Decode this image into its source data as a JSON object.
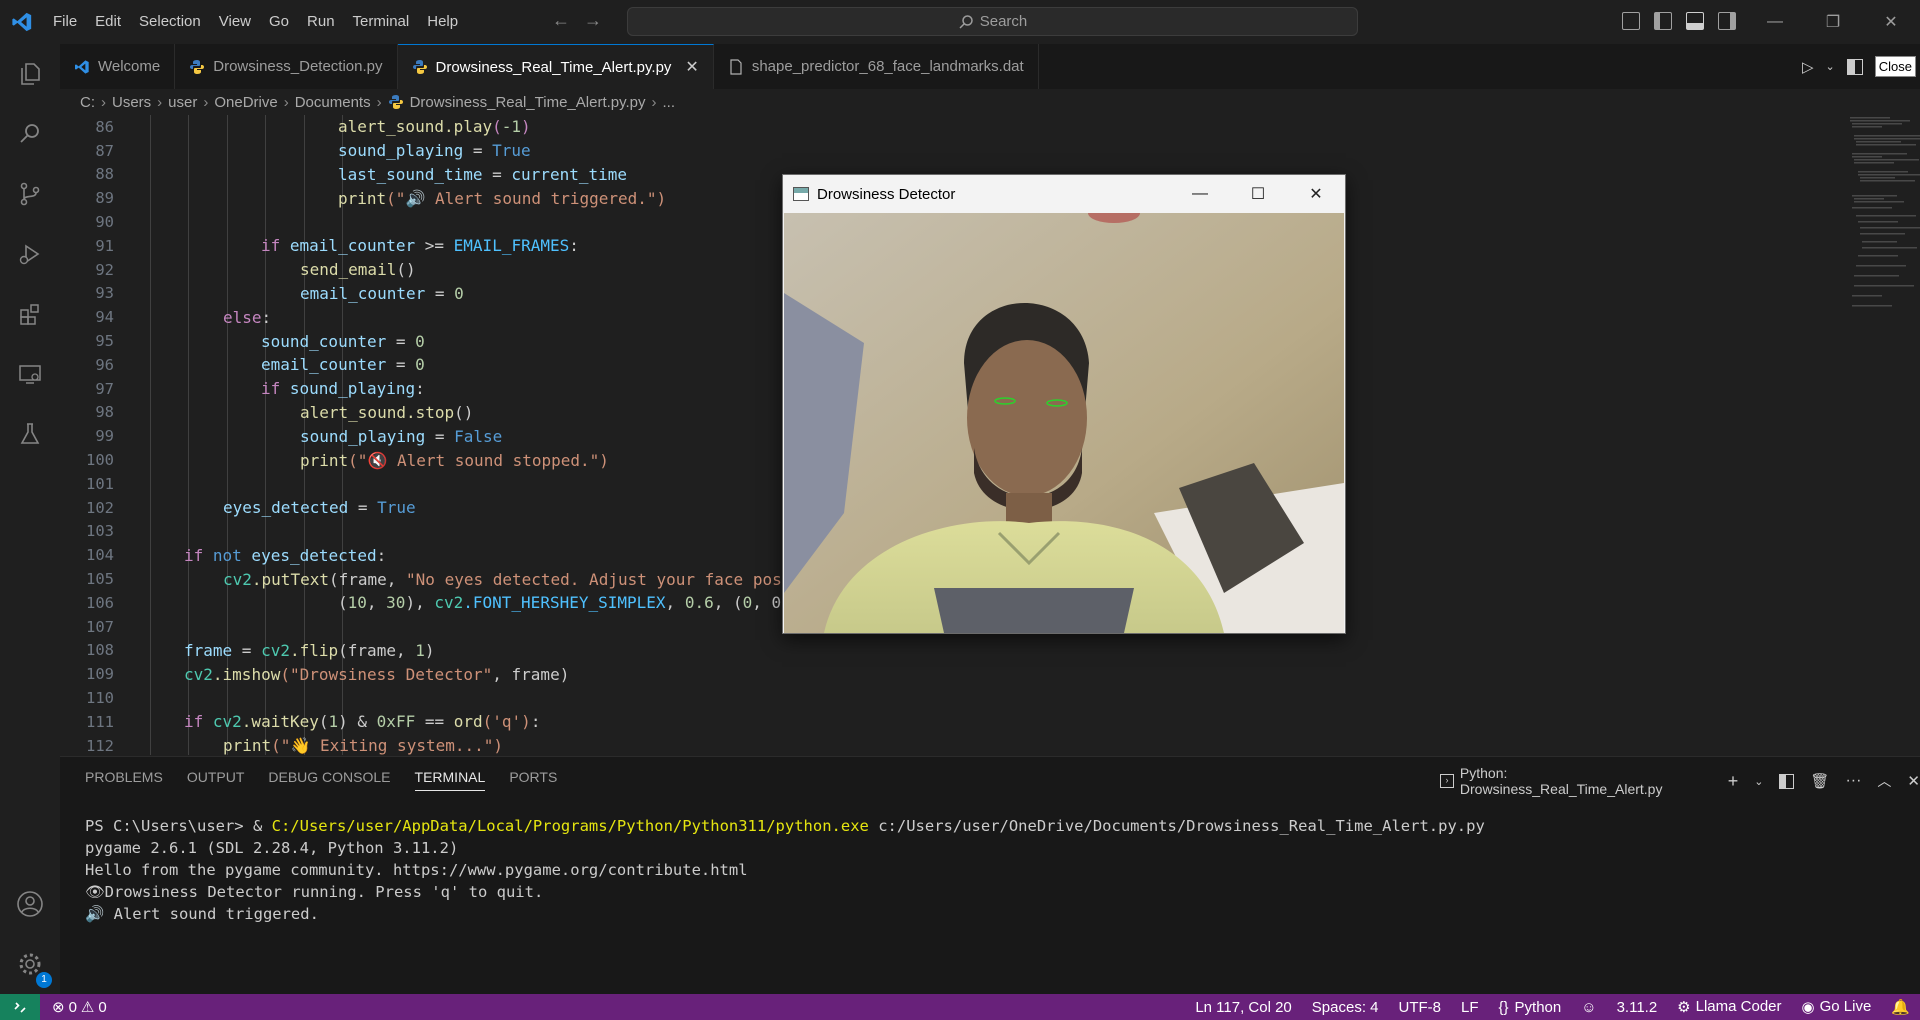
{
  "menu": [
    "File",
    "Edit",
    "Selection",
    "View",
    "Go",
    "Run",
    "Terminal",
    "Help"
  ],
  "search": {
    "label": "Search"
  },
  "tabs": [
    {
      "label": "Welcome",
      "icon": "vscode-icon"
    },
    {
      "label": "Drowsiness_Detection.py",
      "icon": "python-icon"
    },
    {
      "label": "Drowsiness_Real_Time_Alert.py.py",
      "icon": "python-icon",
      "active": true
    },
    {
      "label": "shape_predictor_68_face_landmarks.dat",
      "icon": "file-icon"
    }
  ],
  "tooltip": "Close",
  "breadcrumb": [
    "C:",
    "Users",
    "user",
    "OneDrive",
    "Documents",
    "Drowsiness_Real_Time_Alert.py.py",
    "..."
  ],
  "code": {
    "line_numbers": [
      "86",
      "87",
      "88",
      "89",
      "90",
      "91",
      "92",
      "93",
      "94",
      "95",
      "96",
      "97",
      "98",
      "99",
      "100",
      "101",
      "102",
      "103",
      "104",
      "105",
      "106",
      "107",
      "108",
      "109",
      "110",
      "111",
      "112"
    ],
    "l86_fn": "alert_sound.play",
    "l86_paren": "(",
    "l86_num": "-1",
    "l86_close": ")",
    "l87_var": "sound_playing",
    "l87_op": " = ",
    "l87_val": "True",
    "l88_var": "last_sound_time",
    "l88_op": " = ",
    "l88_val": "current_time",
    "l89_fn": "print",
    "l89_str": "(\"🔊 Alert sound triggered.\")",
    "l91_kw": "if",
    "l91_var": " email_counter",
    "l91_op": " >= ",
    "l91_const": "EMAIL_FRAMES",
    "l91_colon": ":",
    "l92_fn": "send_email",
    "l92_rest": "()",
    "l93_var": "email_counter",
    "l93_op": " = ",
    "l93_num": "0",
    "l94_kw": "else",
    "l94_colon": ":",
    "l95_var": "sound_counter",
    "l95_op": " = ",
    "l95_num": "0",
    "l96_var": "email_counter",
    "l96_op": " = ",
    "l96_num": "0",
    "l97_kw": "if",
    "l97_var": " sound_playing",
    "l97_colon": ":",
    "l98_fn": "alert_sound.stop",
    "l98_rest": "()",
    "l99_var": "sound_playing",
    "l99_op": " = ",
    "l99_val": "False",
    "l100_fn": "print",
    "l100_str": "(\"🔇 Alert sound stopped.\")",
    "l102_var": "eyes_detected",
    "l102_op": " = ",
    "l102_val": "True",
    "l104_kw": "if",
    "l104_kw2": " not",
    "l104_var": " eyes_detected",
    "l104_colon": ":",
    "l105_cls": "cv2",
    "l105_fn": ".putText",
    "l105_args": "(frame, ",
    "l105_str": "\"No eyes detected. Adjust your face pos",
    "l106_args": "(",
    "l106_n1": "10",
    "l106_c": ", ",
    "l106_n2": "30",
    "l106_rest": "), ",
    "l106_cls": "cv2",
    "l106_const": ".FONT_HERSHEY_SIMPLEX",
    "l106_tail": ", ",
    "l106_n3": "0.6",
    "l106_tail2": ", (",
    "l106_n4": "0",
    "l106_tail3": ", 0",
    "l108_var": "frame",
    "l108_op": " = ",
    "l108_cls": "cv2",
    "l108_fn": ".flip",
    "l108_args": "(frame, ",
    "l108_num": "1",
    "l108_close": ")",
    "l109_cls": "cv2",
    "l109_fn": ".imshow",
    "l109_str": "(\"Drowsiness Detector\"",
    "l109_rest": ", frame)",
    "l111_kw": "if",
    "l111_cls": " cv2",
    "l111_fn": ".waitKey",
    "l111_p": "(",
    "l111_n": "1",
    "l111_rest": ") & ",
    "l111_hex": "0xFF",
    "l111_eq": " == ",
    "l111_fn2": "ord",
    "l111_str": "('q')",
    "l111_colon": ":",
    "l112_fn": "print",
    "l112_str": "(\"👋 Exiting system...\")"
  },
  "cv_window": {
    "title": "Drowsiness Detector"
  },
  "panel": {
    "tabs": [
      "PROBLEMS",
      "OUTPUT",
      "DEBUG CONSOLE",
      "TERMINAL",
      "PORTS"
    ],
    "active_tab": "TERMINAL",
    "terminal_name": "Python: Drowsiness_Real_Time_Alert.py",
    "lines": {
      "prompt": "PS C:\\Users\\user> & ",
      "exe": "C:/Users/user/AppData/Local/Programs/Python/Python311/python.exe",
      "script": " c:/Users/user/OneDrive/Documents/Drowsiness_Real_Time_Alert.py.py",
      "l2": "pygame 2.6.1 (SDL 2.28.4, Python 3.11.2)",
      "l3": "Hello from the pygame community. https://www.pygame.org/contribute.html",
      "l4": "👁Drowsiness Detector running. Press 'q' to quit.",
      "l5": "🔊 Alert sound triggered."
    }
  },
  "status": {
    "errors": "0",
    "warnings": "0",
    "position": "Ln 117, Col 20",
    "spaces": "Spaces: 4",
    "encoding": "UTF-8",
    "eol": "LF",
    "language": "Python",
    "version": "3.11.2",
    "llama": "Llama Coder",
    "golive": "Go Live"
  },
  "activity_badge": "1",
  "colors": {
    "statusbar": "#68217a",
    "accent": "#0078d4",
    "keyword": "#c586c0",
    "string": "#ce9178"
  }
}
